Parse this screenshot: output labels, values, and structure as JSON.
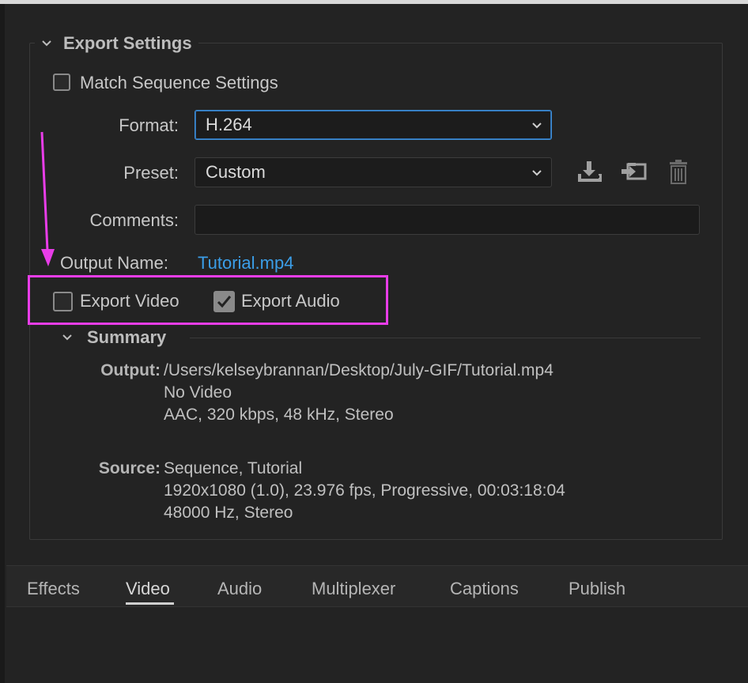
{
  "export_settings": {
    "title": "Export Settings",
    "match_sequence_label": "Match Sequence Settings",
    "format_label": "Format:",
    "format_value": "H.264",
    "preset_label": "Preset:",
    "preset_value": "Custom",
    "comments_label": "Comments:",
    "comments_value": "",
    "output_name_label": "Output Name:",
    "output_name_value": "Tutorial.mp4",
    "export_video_label": "Export Video",
    "export_video_checked": false,
    "export_audio_label": "Export Audio",
    "export_audio_checked": true,
    "match_sequence_checked": false
  },
  "summary": {
    "title": "Summary",
    "output_label": "Output:",
    "output_lines": [
      "/Users/kelseybrannan/Desktop/July-GIF/Tutorial.mp4",
      "No Video",
      "AAC, 320 kbps, 48 kHz, Stereo"
    ],
    "source_label": "Source:",
    "source_lines": [
      "Sequence, Tutorial",
      "1920x1080 (1.0), 23.976 fps, Progressive, 00:03:18:04",
      "48000 Hz, Stereo"
    ]
  },
  "tabs": [
    {
      "label": "Effects"
    },
    {
      "label": "Video"
    },
    {
      "label": "Audio"
    },
    {
      "label": "Multiplexer"
    },
    {
      "label": "Captions"
    },
    {
      "label": "Publish"
    }
  ],
  "active_tab": "Video",
  "icons": {
    "save_preset": "save-preset-icon",
    "import_preset": "import-preset-icon",
    "delete_preset": "trash-icon"
  },
  "colors": {
    "link": "#3b9ee8",
    "focus_border": "#3f8fd8",
    "annotation": "#e83de8"
  }
}
